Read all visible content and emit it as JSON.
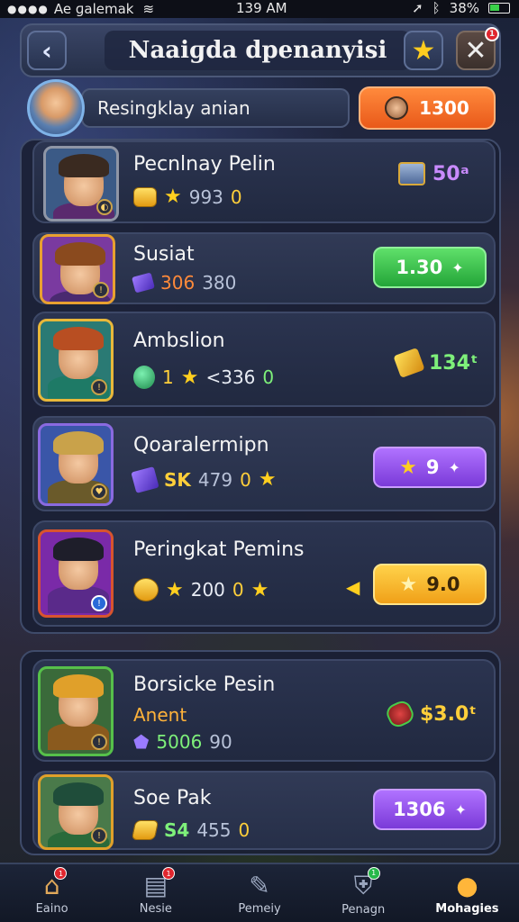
{
  "status_bar": {
    "carrier": "Ae ɡalemak",
    "time": "139 AM",
    "battery": "38%"
  },
  "header": {
    "title": "Naaiɡda dpenanyisi",
    "close_badge": "1"
  },
  "player": {
    "name": "Resingklay anian",
    "currency": "1300"
  },
  "rows": [
    {
      "name": "Pecnlnay Pelin",
      "stat_a": "993",
      "stat_b": "0",
      "reward": "50ᵃ",
      "colors": {
        "hair": "#3a2a20",
        "body": "#5a2a6e",
        "bg": "#3b5a86",
        "border": "#8f96a6"
      }
    },
    {
      "name": "Susiat",
      "stat_a": "306",
      "stat_b": "380",
      "button": "1.30",
      "colors": {
        "hair": "#8a4a1e",
        "body": "#4a2a70",
        "bg": "#7a3aa0",
        "border": "#e8a030"
      }
    },
    {
      "name": "Ambslion",
      "stat_a": "1",
      "stat_b": "<336",
      "stat_c": "0",
      "reward": "134ᵗ",
      "colors": {
        "hair": "#b84e22",
        "body": "#1e7a66",
        "bg": "#2a7a74",
        "border": "#e8b83a"
      }
    },
    {
      "name": "Qoaralermipn",
      "stat_a": "SK",
      "stat_b": "479",
      "stat_c": "0",
      "button": "9",
      "colors": {
        "hair": "#c9a24a",
        "body": "#6a5a2a",
        "bg": "#3a56a8",
        "border": "#8a6ae0"
      }
    },
    {
      "name": "Peringkat Pemins",
      "stat_a": "200",
      "stat_b": "0",
      "button": "9.0",
      "colors": {
        "hair": "#1e1e2a",
        "body": "#5a2a8a",
        "bg": "#7a2aa8",
        "border": "#d8542e"
      }
    },
    {
      "name": "Borsicke Pesin",
      "sub": "Anent",
      "stat_a": "5006",
      "stat_b": "90",
      "reward": "$3.0ᵗ",
      "colors": {
        "hair": "#e0a02a",
        "body": "#8a5a1e",
        "bg": "#3a6a3a",
        "border": "#56c04a"
      }
    },
    {
      "name": "Soe Pak",
      "stat_a": "S4",
      "stat_b": "455",
      "stat_c": "0",
      "button": "1306",
      "colors": {
        "hair": "#1f4d3a",
        "body": "#2a6a3a",
        "bg": "#4a7a4a",
        "border": "#e0a02a"
      }
    }
  ],
  "nav": [
    {
      "label": "Eaino",
      "icon": "home-icon",
      "badge": "1"
    },
    {
      "label": "Nesie",
      "icon": "chat-icon",
      "badge": "1"
    },
    {
      "label": "Pemeiy",
      "icon": "edit-icon"
    },
    {
      "label": "Penagn",
      "icon": "shield-icon",
      "badge": "1"
    },
    {
      "label": "Mohagies",
      "icon": "coins-icon"
    }
  ]
}
